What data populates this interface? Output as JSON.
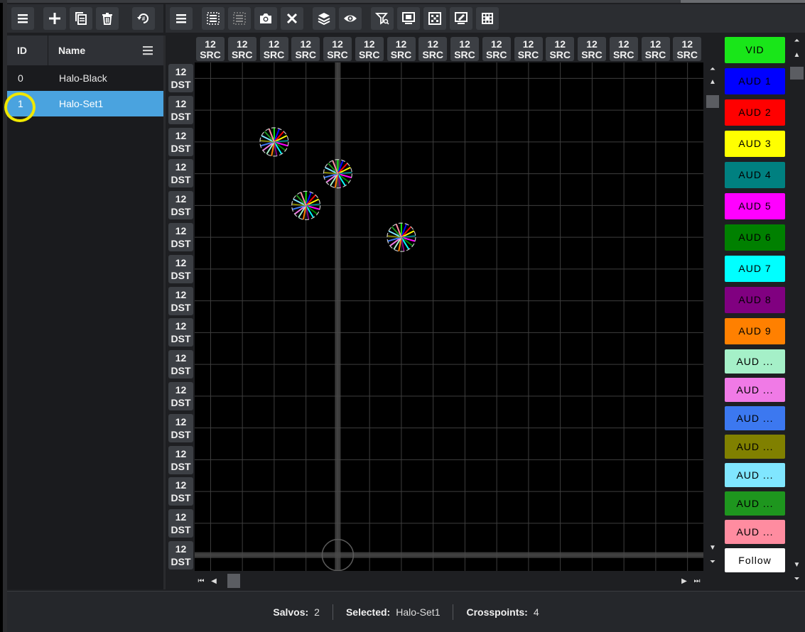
{
  "toolbar_left": {
    "buttons": [
      {
        "name": "menu-icon"
      },
      {
        "name": "add-icon"
      },
      {
        "name": "copy-icon"
      },
      {
        "name": "delete-icon"
      },
      {
        "name": "renumber-icon"
      }
    ]
  },
  "toolbar_right": {
    "buttons": [
      {
        "name": "menu-icon"
      },
      {
        "name": "select-all-icon"
      },
      {
        "name": "deselect-icon"
      },
      {
        "name": "camera-icon"
      },
      {
        "name": "close-icon"
      },
      {
        "name": "layers-icon"
      },
      {
        "name": "eye-icon"
      },
      {
        "name": "filter-search-icon"
      },
      {
        "name": "monitor-icon"
      },
      {
        "name": "grid-icon"
      },
      {
        "name": "monitor-edit-icon"
      },
      {
        "name": "grid-dots-icon"
      }
    ]
  },
  "salvo_list": {
    "columns": {
      "id": "ID",
      "name": "Name"
    },
    "rows": [
      {
        "id": "0",
        "name": "Halo-Black",
        "selected": false
      },
      {
        "id": "1",
        "name": "Halo-Set1",
        "selected": true
      }
    ]
  },
  "matrix": {
    "source_label_top": "12",
    "source_label_bottom": "SRC",
    "dest_label_top": "12",
    "dest_label_bottom": "DST",
    "source_count": 16,
    "dest_count": 16,
    "crosspoints": [
      {
        "src": 2,
        "dst": 2
      },
      {
        "src": 4,
        "dst": 3
      },
      {
        "src": 3,
        "dst": 4
      },
      {
        "src": 6,
        "dst": 5
      }
    ]
  },
  "levels": [
    {
      "label": "VID",
      "color": "#19e619"
    },
    {
      "label": "AUD 1",
      "color": "#0000ff"
    },
    {
      "label": "AUD 2",
      "color": "#ff0000"
    },
    {
      "label": "AUD 3",
      "color": "#ffff00"
    },
    {
      "label": "AUD 4",
      "color": "#008080"
    },
    {
      "label": "AUD 5",
      "color": "#ff00ff"
    },
    {
      "label": "AUD 6",
      "color": "#008000"
    },
    {
      "label": "AUD 7",
      "color": "#00ffff"
    },
    {
      "label": "AUD 8",
      "color": "#800080"
    },
    {
      "label": "AUD 9",
      "color": "#ff8000"
    },
    {
      "label": "AUD ...",
      "color": "#a5f0c8"
    },
    {
      "label": "AUD ...",
      "color": "#f07ae6"
    },
    {
      "label": "AUD ...",
      "color": "#3c78f0"
    },
    {
      "label": "AUD ...",
      "color": "#808000"
    },
    {
      "label": "AUD ...",
      "color": "#80e6ff"
    },
    {
      "label": "AUD ...",
      "color": "#1e961e"
    },
    {
      "label": "AUD ...",
      "color": "#ff8ca0"
    },
    {
      "label": "Follow",
      "color": "#ffffff"
    }
  ],
  "status": {
    "salvos_label": "Salvos:",
    "salvos_value": "2",
    "selected_label": "Selected:",
    "selected_value": "Halo-Set1",
    "crosspoints_label": "Crosspoints:",
    "crosspoints_value": "4"
  }
}
